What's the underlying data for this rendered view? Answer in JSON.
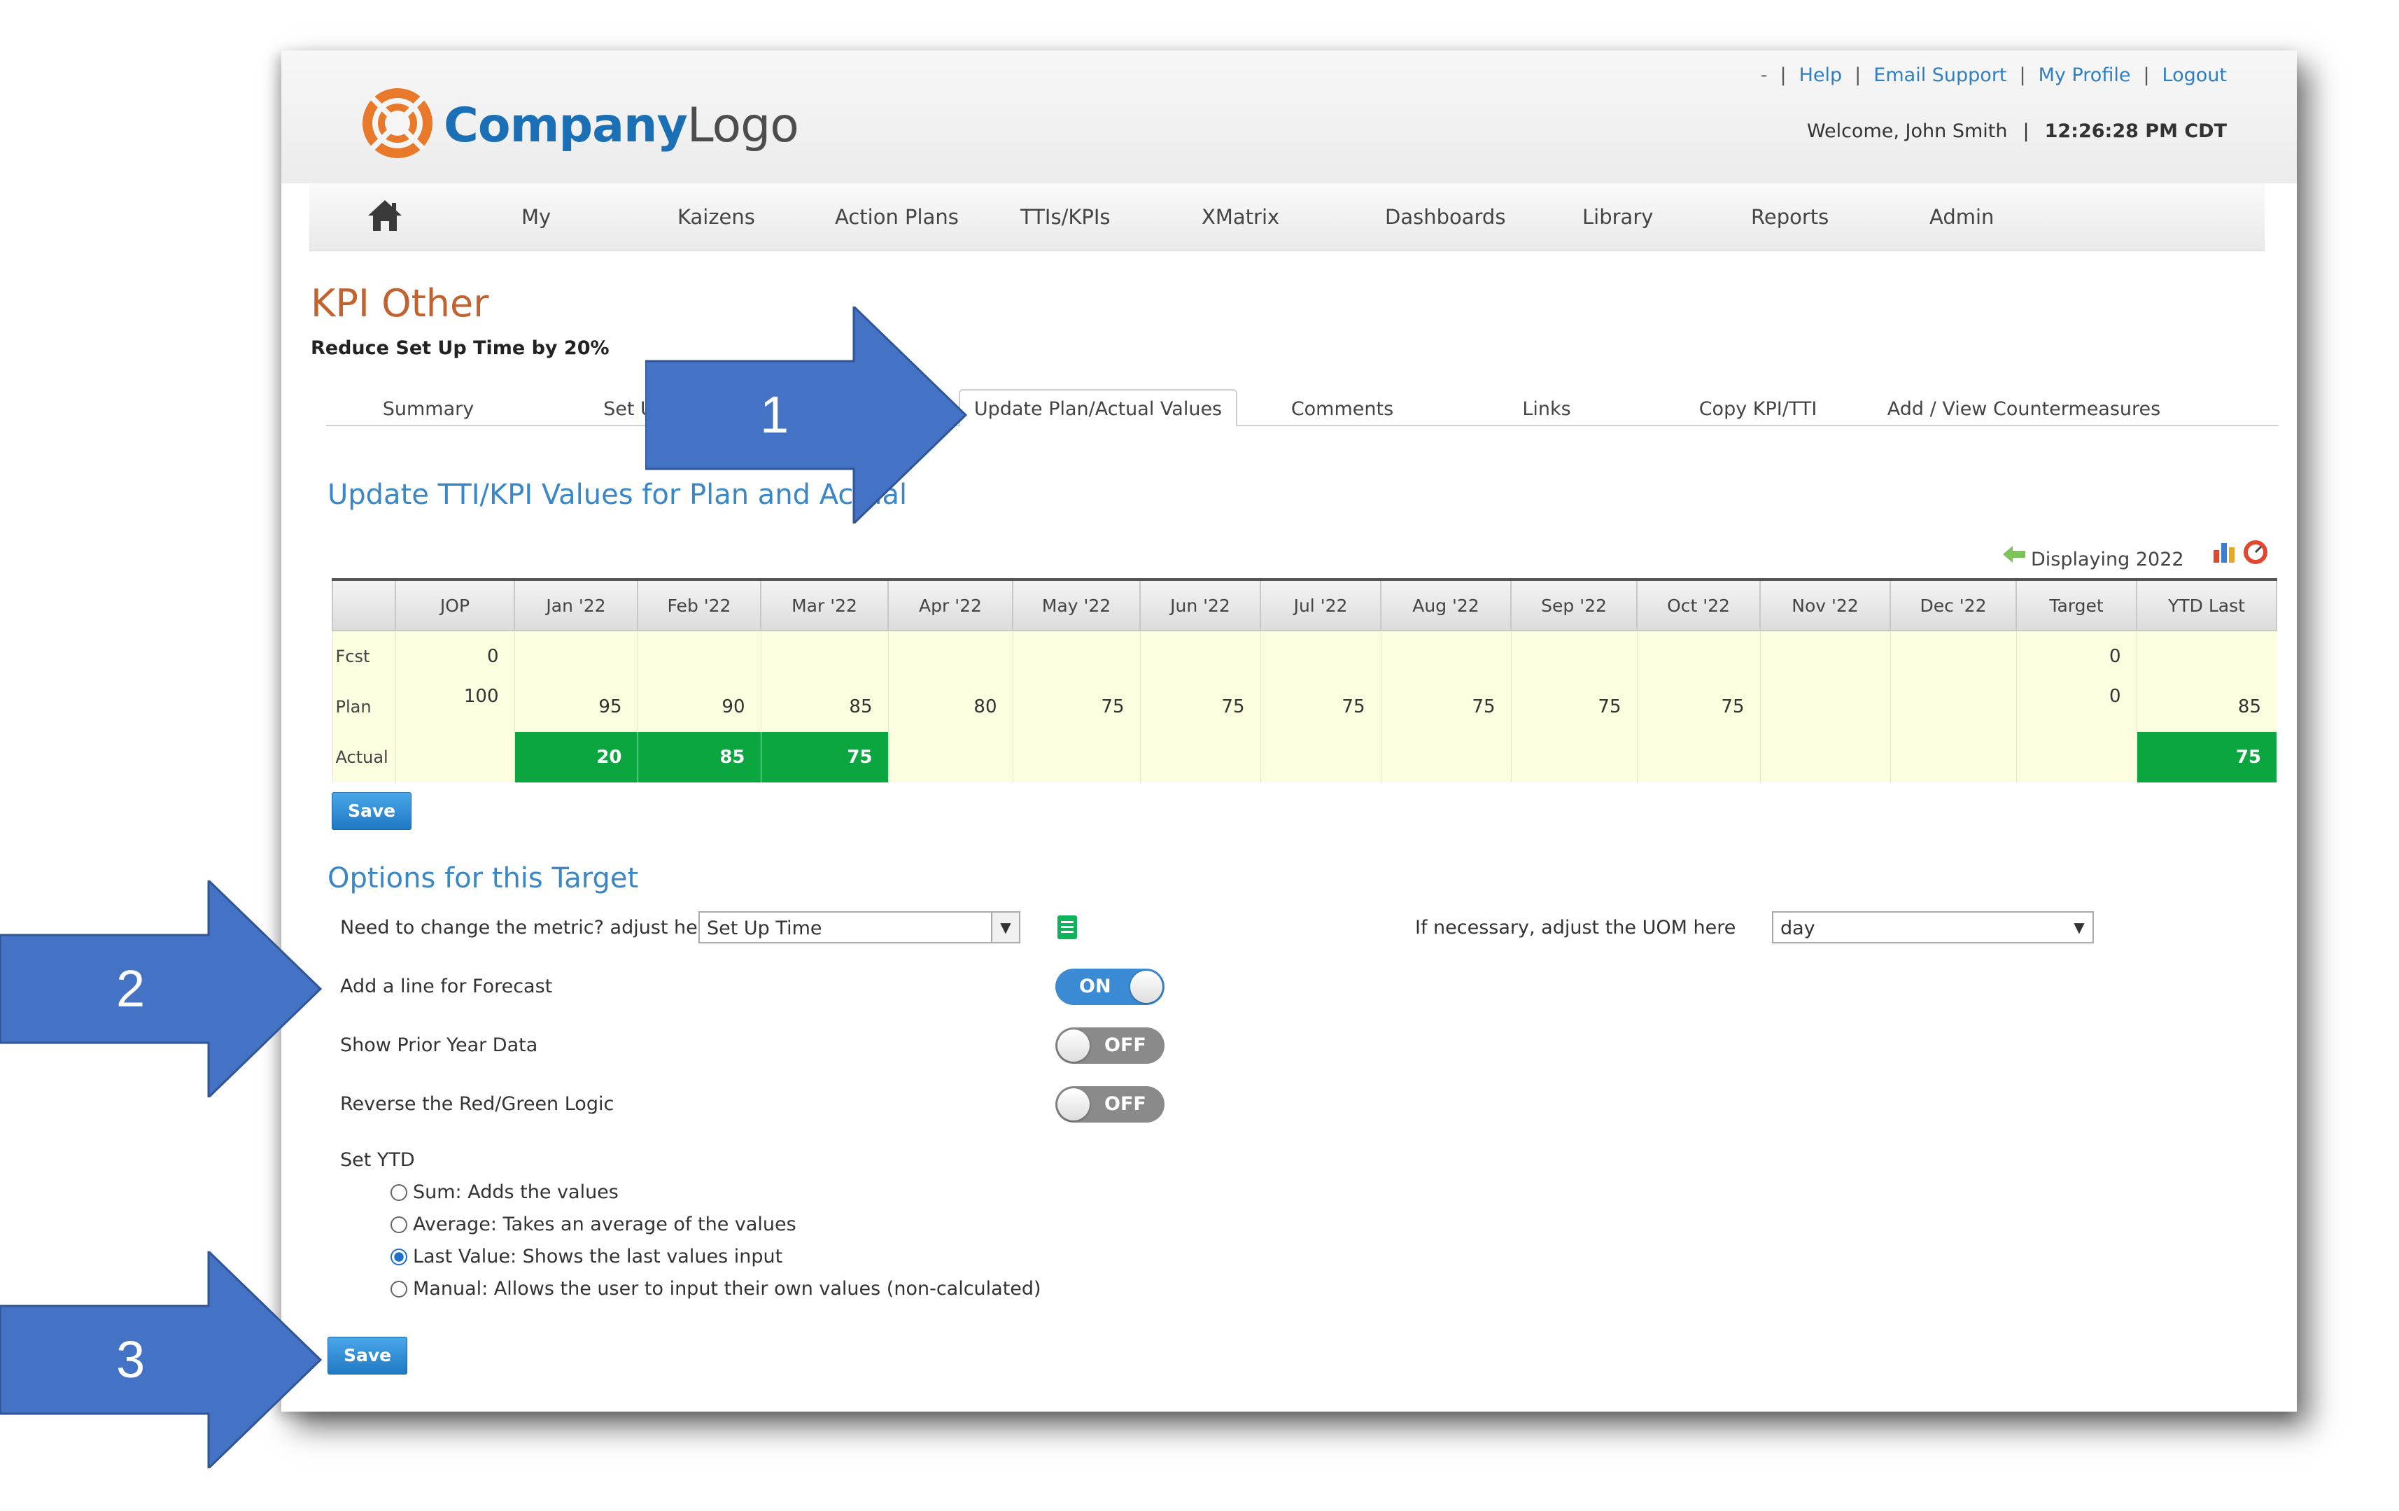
{
  "header": {
    "logo": {
      "part1": "Company",
      "part2": "Logo"
    },
    "top_links": [
      "-",
      "Help",
      "Email Support",
      "My Profile",
      "Logout"
    ],
    "welcome": "Welcome, John Smith",
    "time": "12:26:28 PM CDT"
  },
  "nav": {
    "items": [
      "My",
      "Kaizens",
      "Action Plans",
      "TTIs/KPIs",
      "XMatrix",
      "Dashboards",
      "Library",
      "Reports",
      "Admin"
    ]
  },
  "page": {
    "title": "KPI Other",
    "subtitle": "Reduce Set Up Time by 20%"
  },
  "tabs": [
    "Summary",
    "Set Up",
    "Update Plan/Actual Values",
    "Comments",
    "Links",
    "Copy KPI/TTI",
    "Add / View Countermeasures"
  ],
  "values_section": {
    "title": "Update TTI/KPI Values for Plan and Actual",
    "displaying": "Displaying 2022",
    "columns": [
      "",
      "JOP",
      "Jan '22",
      "Feb '22",
      "Mar '22",
      "Apr '22",
      "May '22",
      "Jun '22",
      "Jul '22",
      "Aug '22",
      "Sep '22",
      "Oct '22",
      "Nov '22",
      "Dec '22",
      "Target",
      "YTD Last"
    ],
    "rows": {
      "fcst": {
        "label": "Fcst",
        "jop": "0",
        "target": "0"
      },
      "plan": {
        "label": "Plan",
        "jop": "100",
        "values": [
          "95",
          "90",
          "85",
          "80",
          "75",
          "75",
          "75",
          "75",
          "75",
          "75",
          "",
          ""
        ],
        "target": "0",
        "ytd": "85"
      },
      "actual": {
        "label": "Actual",
        "values": [
          "20",
          "85",
          "75"
        ],
        "ytd": "75"
      }
    },
    "save_label": "Save",
    "status_colors": {
      "green": "#0ba640",
      "cell": "#fdfde0"
    }
  },
  "options": {
    "title": "Options for this Target",
    "metric_label": "Need to change the metric? adjust here",
    "metric_value": "Set Up Time",
    "uom_label": "If necessary, adjust the UOM here",
    "uom_value": "day",
    "forecast_label": "Add a line for Forecast",
    "forecast_state": "ON",
    "prior_label": "Show Prior Year Data",
    "prior_state": "OFF",
    "reverse_label": "Reverse the Red/Green Logic",
    "reverse_state": "OFF",
    "ytd_label": "Set YTD",
    "ytd_options": [
      "Sum: Adds the values",
      "Average: Takes an average of the values",
      "Last Value: Shows the last values input",
      "Manual: Allows the user to input their own values (non-calculated)"
    ],
    "ytd_selected_index": 2,
    "save_label": "Save"
  },
  "callouts": [
    "1",
    "2",
    "3"
  ]
}
